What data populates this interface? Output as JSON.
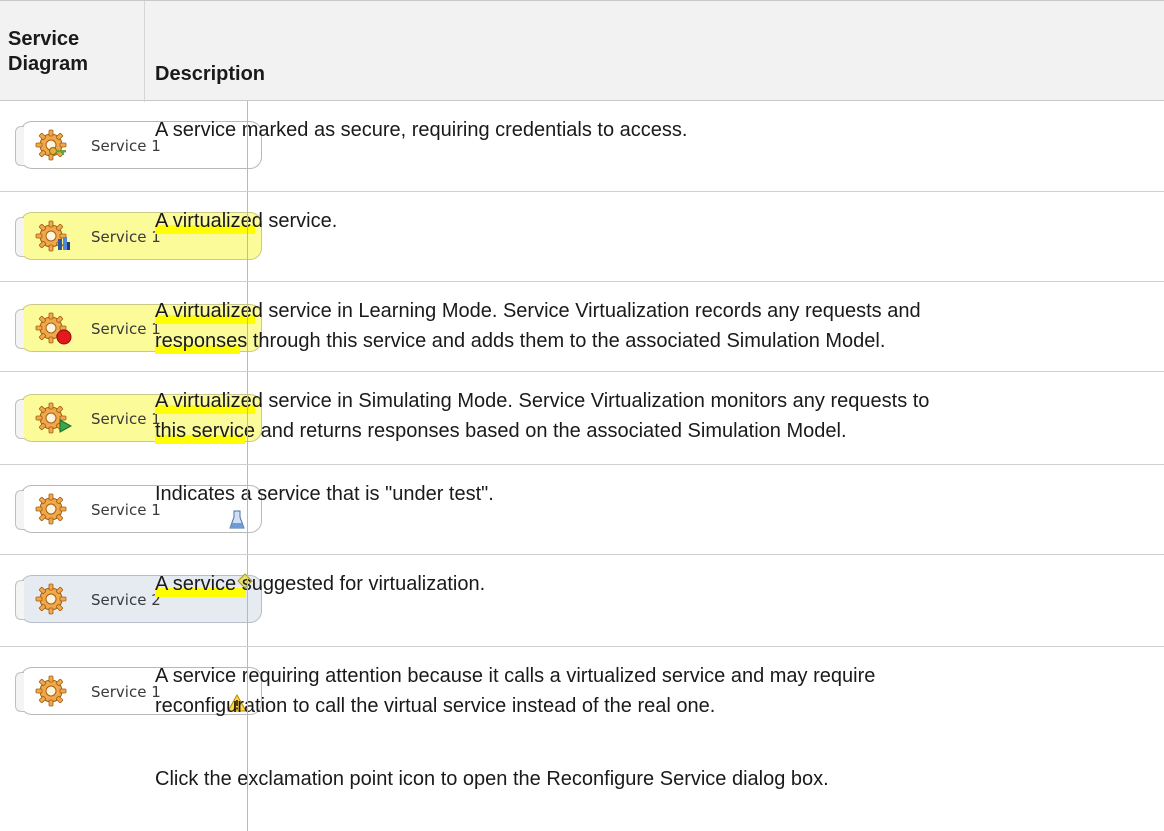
{
  "header": {
    "col1_line1": "Service",
    "col1_line2": "Diagram",
    "col2": "Description"
  },
  "rows": [
    {
      "node_label": "Service 1",
      "node_style": "white",
      "badge": "key-icon",
      "line1_pre": "A ",
      "line1_hl": "",
      "line1": "A service marked as secure, requiring credentials to access.",
      "line2": ""
    },
    {
      "node_label": "Service 1",
      "node_style": "yellow",
      "badge": "virtual-icon",
      "line1": "A virtualized service.",
      "line2": ""
    },
    {
      "node_label": "Service 1",
      "node_style": "yellow",
      "badge": "record-icon",
      "line1": "A virtualized service in Learning Mode. Service Virtualization records any requests and",
      "line2": "responses through this service and adds them to the associated Simulation Model."
    },
    {
      "node_label": "Service 1",
      "node_style": "yellow",
      "badge": "play-icon",
      "line1": "A virtualized service in Simulating Mode. Service Virtualization monitors any requests to",
      "line2": "this service and returns responses based on the associated Simulation Model."
    },
    {
      "node_label": "Service 1",
      "node_style": "white",
      "badge": "flask-icon",
      "line1": "Indicates a service that is \"under test\".",
      "line2": ""
    },
    {
      "node_label": "Service 2",
      "node_style": "grey",
      "badge": "suggest-icon",
      "line1": "A service suggested for virtualization.",
      "line2": ""
    },
    {
      "node_label": "Service 1",
      "node_style": "white",
      "badge": "warning-icon",
      "line1": "A service requiring attention because it calls a virtualized service and may require",
      "line2": "reconfiguration to call the virtual service instead of the real one.",
      "line3": "Click the exclamation point icon to open the Reconfigure Service dialog box."
    }
  ],
  "colors": {
    "header_bg": "#f2f2f2",
    "node_yellow": "#fbfb9a",
    "node_grey": "#e6eaf1",
    "highlight": "#ffff00"
  }
}
